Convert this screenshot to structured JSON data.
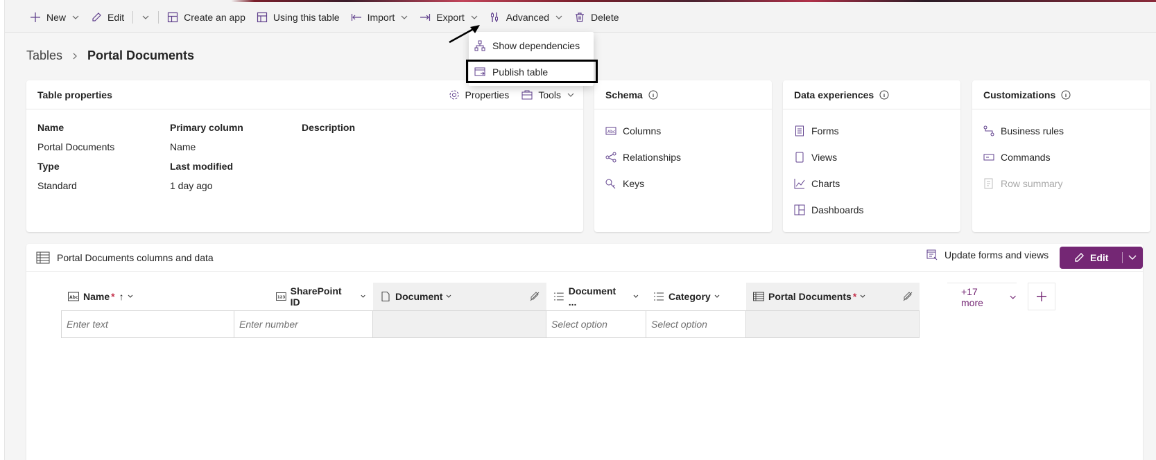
{
  "toolbar": {
    "new": "New",
    "edit": "Edit",
    "create_app": "Create an app",
    "using_table": "Using this table",
    "import": "Import",
    "export": "Export",
    "advanced": "Advanced",
    "delete": "Delete"
  },
  "advanced_menu": {
    "show_dependencies": "Show dependencies",
    "publish_table": "Publish table"
  },
  "breadcrumb": {
    "root": "Tables",
    "current": "Portal Documents"
  },
  "table_properties": {
    "title": "Table properties",
    "properties_btn": "Properties",
    "tools_btn": "Tools",
    "fields": {
      "name_label": "Name",
      "name_value": "Portal Documents",
      "primary_label": "Primary column",
      "primary_value": "Name",
      "description_label": "Description",
      "type_label": "Type",
      "type_value": "Standard",
      "modified_label": "Last modified",
      "modified_value": "1 day ago"
    }
  },
  "schema": {
    "title": "Schema",
    "items": [
      "Columns",
      "Relationships",
      "Keys"
    ]
  },
  "data_experiences": {
    "title": "Data experiences",
    "items": [
      "Forms",
      "Views",
      "Charts",
      "Dashboards"
    ]
  },
  "customizations": {
    "title": "Customizations",
    "items": [
      "Business rules",
      "Commands",
      "Row summary"
    ]
  },
  "data_section": {
    "title": "Portal Documents columns and data",
    "update_forms": "Update forms and views",
    "edit": "Edit",
    "columns": [
      {
        "label": "Name",
        "required": "*",
        "placeholder": "Enter text"
      },
      {
        "label": "SharePoint ID",
        "required": "",
        "placeholder": "Enter number"
      },
      {
        "label": "Document",
        "required": "",
        "placeholder": ""
      },
      {
        "label": "Document ...",
        "required": "",
        "placeholder": "Select option"
      },
      {
        "label": "Category",
        "required": "",
        "placeholder": "Select option"
      },
      {
        "label": "Portal Documents",
        "required": "*",
        "placeholder": ""
      }
    ],
    "sort_indicator": "↑",
    "more": "+17 more"
  },
  "colors": {
    "accent": "#742774",
    "icon": "#5f3f8c",
    "required": "#c4314b"
  }
}
